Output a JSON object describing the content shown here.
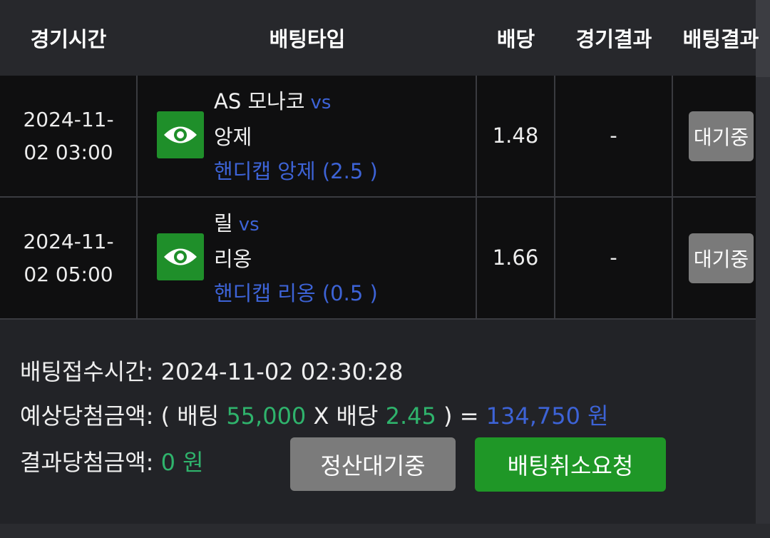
{
  "header": {
    "col_time": "경기시간",
    "col_type": "배팅타입",
    "col_odds": "배당",
    "col_game_result": "경기결과",
    "col_bet_result": "배팅결과"
  },
  "rows": [
    {
      "time_line1": "2024-11-",
      "time_line2": "02 03:00",
      "home": "AS 모나코",
      "vs": "vs",
      "away": "앙제",
      "handicap": "핸디캡 앙제 (2.5 )",
      "odds": "1.48",
      "game_result": "-",
      "status": "대기중"
    },
    {
      "time_line1": "2024-11-",
      "time_line2": "02 05:00",
      "home": "릴",
      "vs": "vs",
      "away": "리옹",
      "handicap": "핸디캡 리옹 (0.5 )",
      "odds": "1.66",
      "game_result": "-",
      "status": "대기중"
    }
  ],
  "summary": {
    "accept_label": "배팅접수시간:",
    "accept_time": "2024-11-02 02:30:28",
    "expected_label": "예상당첨금액:",
    "paren_open": "( 배팅",
    "bet_amount": "55,000",
    "times_label": "X 배당",
    "total_odds": "2.45",
    "paren_close": ") =",
    "expected_amount": "134,750 원",
    "result_label": "결과당첨금액:",
    "result_amount": "0 원"
  },
  "buttons": {
    "settle": "정산대기중",
    "cancel": "배팅취소요청"
  },
  "icons": {
    "view": "eye-icon"
  },
  "colors": {
    "accent_blue": "#3d63d6",
    "accent_green": "#2fb36c",
    "button_green": "#1f9727",
    "button_gray": "#7b7b7b"
  }
}
